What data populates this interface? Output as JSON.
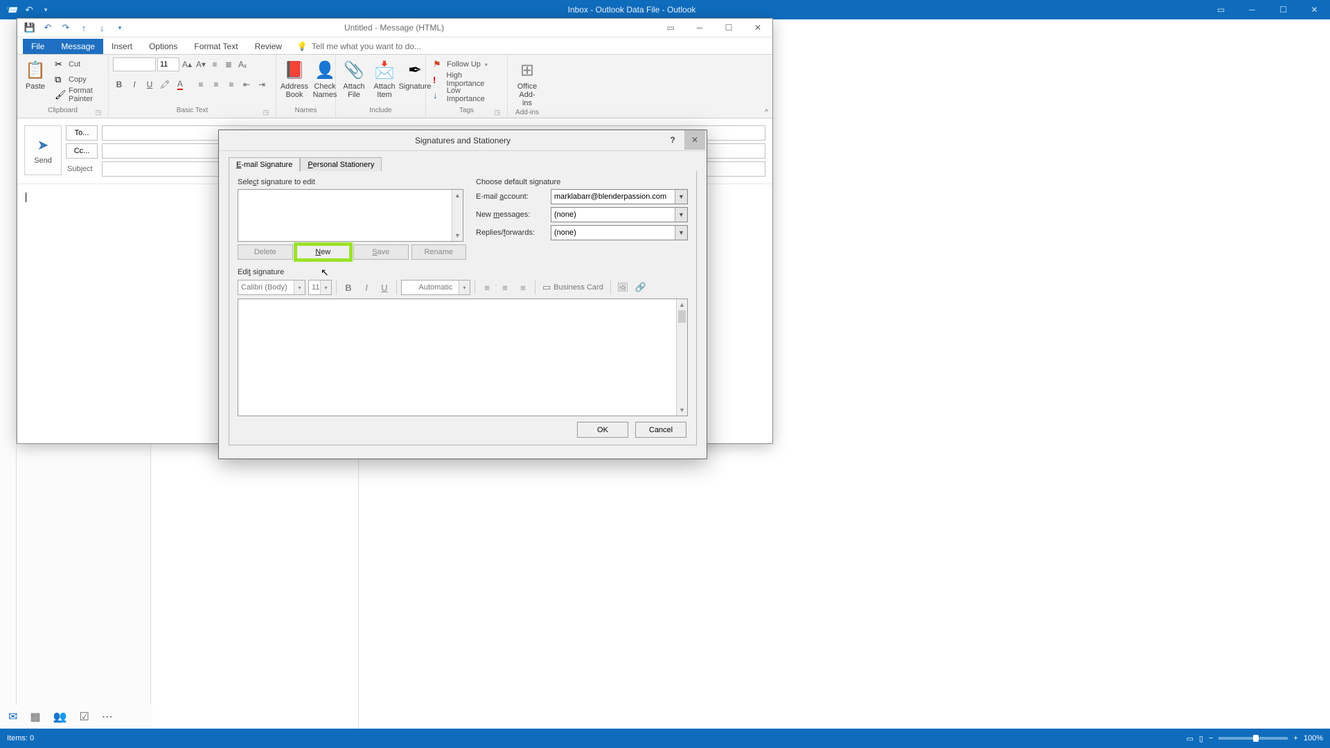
{
  "main_window": {
    "title": "Inbox - Outlook Data File - Outlook"
  },
  "statusbar": {
    "items": "Items: 0",
    "zoom": "100%"
  },
  "msg_window": {
    "title": "Untitled - Message (HTML)",
    "tabs": {
      "file": "File",
      "message": "Message",
      "insert": "Insert",
      "options": "Options",
      "format": "Format Text",
      "review": "Review",
      "tellme": "Tell me what you want to do..."
    },
    "ribbon": {
      "clipboard": {
        "label": "Clipboard",
        "paste": "Paste",
        "cut": "Cut",
        "copy": "Copy",
        "painter": "Format Painter"
      },
      "basictext": {
        "label": "Basic Text",
        "font_size": "11"
      },
      "names": {
        "label": "Names",
        "address": "Address\nBook",
        "check": "Check\nNames"
      },
      "include": {
        "label": "Include",
        "attachfile": "Attach\nFile",
        "attachitem": "Attach\nItem",
        "signature": "Signature"
      },
      "tags": {
        "label": "Tags",
        "followup": "Follow Up",
        "high": "High Importance",
        "low": "Low Importance"
      },
      "addins": {
        "label": "Add-ins",
        "office": "Office\nAdd-ins"
      }
    },
    "compose": {
      "send": "Send",
      "to": "To...",
      "cc": "Cc...",
      "subject": "Subject"
    }
  },
  "sig_dialog": {
    "title": "Signatures and Stationery",
    "tabs": {
      "email": "E-mail Signature",
      "personal": "Personal Stationery"
    },
    "select_label": "Select signature to edit",
    "buttons": {
      "delete": "Delete",
      "new": "New",
      "save": "Save",
      "rename": "Rename"
    },
    "default_label": "Choose default signature",
    "account_label": "E-mail account:",
    "account_value": "marklabarr@blenderpassion.com",
    "newmsg_label": "New messages:",
    "newmsg_value": "(none)",
    "replies_label": "Replies/forwards:",
    "replies_value": "(none)",
    "edit_label": "Edit signature",
    "toolbar": {
      "font": "Calibri (Body)",
      "size": "11",
      "auto": "Automatic",
      "bizcard": "Business Card"
    },
    "ok": "OK",
    "cancel": "Cancel"
  }
}
